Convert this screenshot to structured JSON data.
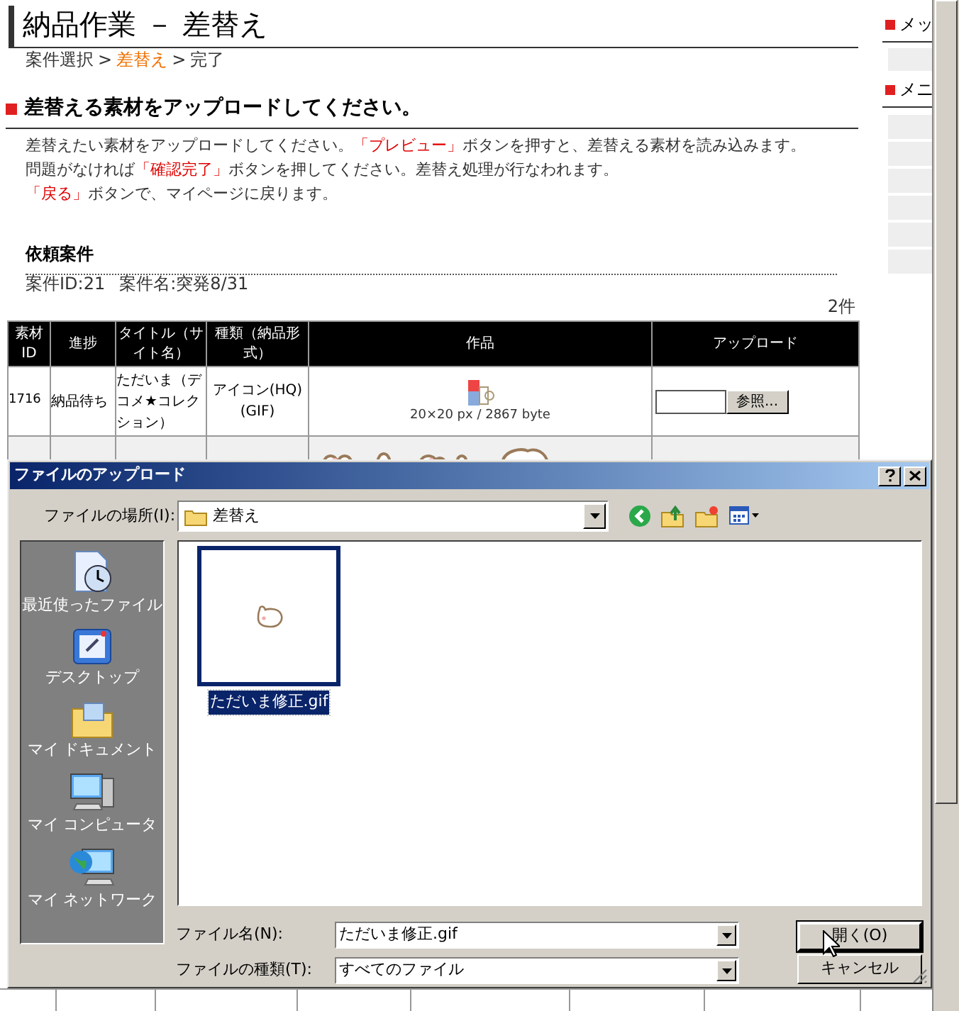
{
  "page_title": "納品作業 － 差替え",
  "breadcrumb": [
    {
      "kind": "step",
      "label": "案件選択",
      "selected": false
    },
    {
      "kind": "separator",
      "label": ">"
    },
    {
      "kind": "step",
      "label": "差替え",
      "selected": true
    },
    {
      "kind": "separator",
      "label": ">"
    },
    {
      "kind": "step",
      "label": "完了",
      "selected": false
    }
  ],
  "section_heading": "差替える素材をアップロードしてください。",
  "instructions": [
    [
      {
        "text": "差替えたい素材をアップロードしてください。",
        "highlight": false
      },
      {
        "text": "「プレビュー」",
        "highlight": true
      },
      {
        "text": "ボタンを押すと、差替える素材を読み込みます。",
        "highlight": false
      }
    ],
    [
      {
        "text": "問題がなければ",
        "highlight": false
      },
      {
        "text": "「確認完了」",
        "highlight": true
      },
      {
        "text": "ボタンを押してください。差替え処理が行なわれます。",
        "highlight": false
      }
    ],
    [
      {
        "text": "「戻る」",
        "highlight": true
      },
      {
        "text": "ボタンで、マイページに戻ります。",
        "highlight": false
      }
    ]
  ],
  "request": {
    "heading": "依頼案件",
    "case_id": "案件ID:21",
    "case_name": "案件名:突発8/31"
  },
  "count": "2件",
  "table": {
    "columns": [
      "素材ID",
      "進捗",
      "タイトル（サイト名）",
      "種類（納品形式）",
      "作品",
      "アップロード"
    ],
    "rows": [
      {
        "material_id": "1716",
        "status": "納品待ち",
        "title": "ただいま（デコメ★コレクション）",
        "type": "アイコン(HQ)\n(GIF)",
        "work": {
          "kind": "picture",
          "caption": "20×20 px / 2867 byte"
        },
        "upload_button": "参照..."
      },
      {
        "work": {
          "kind": "picture"
        }
      }
    ]
  },
  "sidebar": {
    "sections": [
      "メッ",
      "メニ"
    ]
  },
  "dialog": {
    "title": "ファイルのアップロード",
    "location_label": "ファイルの場所(I):",
    "location": "差替え",
    "places": [
      "最近使ったファイル",
      "デスクトップ",
      "マイ ドキュメント",
      "マイ コンピュータ",
      "マイ ネットワーク"
    ],
    "files": [
      {
        "name": "ただいま修正.gif",
        "selected": true
      }
    ],
    "file_name_label": "ファイル名(N):",
    "file_name": "ただいま修正.gif",
    "file_type_label": "ファイルの種類(T):",
    "file_type": "すべてのファイル",
    "buttons": [
      "開く(O)",
      "キャンセル"
    ]
  }
}
